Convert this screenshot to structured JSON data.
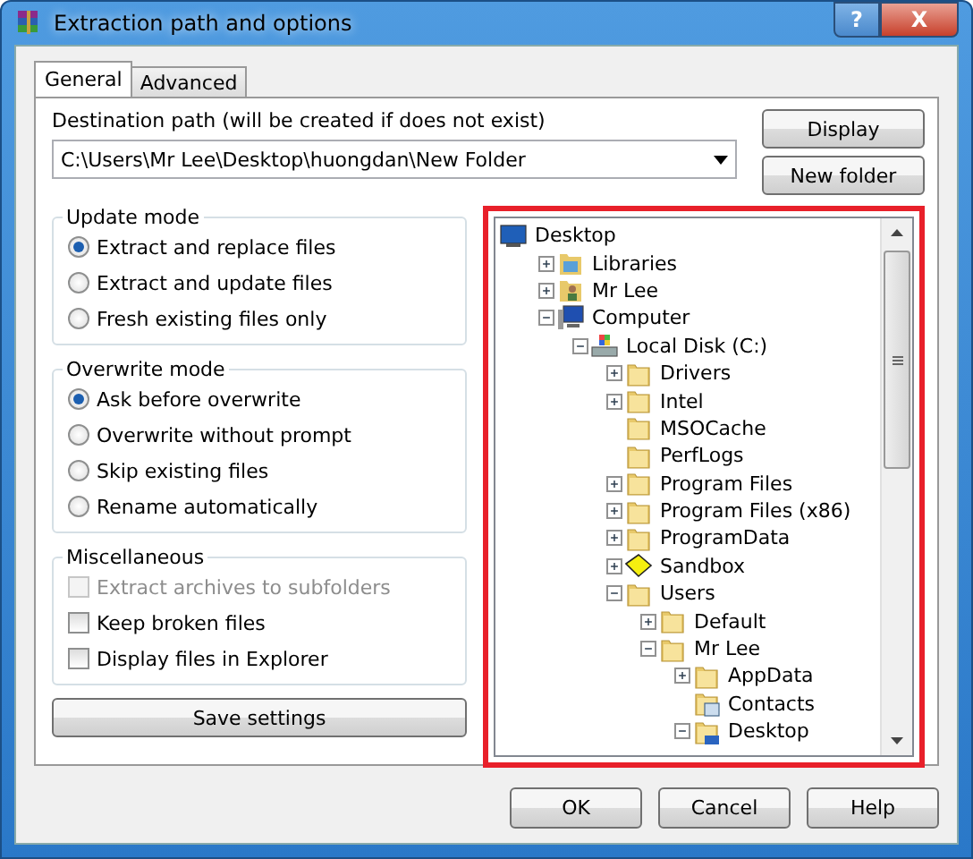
{
  "window": {
    "title": "Extraction path and options",
    "buttons": [
      {
        "kind": "help",
        "label": "?"
      },
      {
        "kind": "close",
        "label": "X"
      }
    ]
  },
  "tabs": [
    {
      "label": "General",
      "selected": true
    },
    {
      "label": "Advanced",
      "selected": false
    }
  ],
  "destination": {
    "label": "Destination path (will be created if does not exist)",
    "value": "C:\\Users\\Mr Lee\\Desktop\\huongdan\\New Folder"
  },
  "side_buttons": [
    "Display",
    "New folder"
  ],
  "update_mode": {
    "title": "Update mode",
    "options": [
      {
        "label": "Extract and replace files",
        "selected": true
      },
      {
        "label": "Extract and update files",
        "selected": false
      },
      {
        "label": "Fresh existing files only",
        "selected": false
      }
    ]
  },
  "overwrite_mode": {
    "title": "Overwrite mode",
    "options": [
      {
        "label": "Ask before overwrite",
        "selected": true
      },
      {
        "label": "Overwrite without prompt",
        "selected": false
      },
      {
        "label": "Skip existing files",
        "selected": false
      },
      {
        "label": "Rename automatically",
        "selected": false
      }
    ]
  },
  "miscellaneous": {
    "title": "Miscellaneous",
    "options": [
      {
        "label": "Extract archives to subfolders",
        "checked": false,
        "disabled": true
      },
      {
        "label": "Keep broken files",
        "checked": false,
        "disabled": false
      },
      {
        "label": "Display files in Explorer",
        "checked": false,
        "disabled": false
      }
    ]
  },
  "save_button": "Save settings",
  "tree": [
    {
      "label": "Desktop",
      "kind": "desktop",
      "children": [
        {
          "label": "Libraries",
          "kind": "library",
          "expanded": false
        },
        {
          "label": "Mr Lee",
          "kind": "user",
          "expanded": false
        },
        {
          "label": "Computer",
          "kind": "computer",
          "expanded": true,
          "children": [
            {
              "label": "Local Disk (C:)",
              "kind": "drive",
              "expanded": true,
              "children": [
                {
                  "label": "Drivers",
                  "kind": "folder",
                  "expanded": false
                },
                {
                  "label": "Intel",
                  "kind": "folder",
                  "expanded": false
                },
                {
                  "label": "MSOCache",
                  "kind": "folder"
                },
                {
                  "label": "PerfLogs",
                  "kind": "folder"
                },
                {
                  "label": "Program Files",
                  "kind": "folder",
                  "expanded": false
                },
                {
                  "label": "Program Files (x86)",
                  "kind": "folder",
                  "expanded": false
                },
                {
                  "label": "ProgramData",
                  "kind": "folder",
                  "expanded": false
                },
                {
                  "label": "Sandbox",
                  "kind": "sandbox",
                  "expanded": false
                },
                {
                  "label": "Users",
                  "kind": "folder",
                  "expanded": true,
                  "children": [
                    {
                      "label": "Default",
                      "kind": "folder",
                      "expanded": false
                    },
                    {
                      "label": "Mr Lee",
                      "kind": "folder",
                      "expanded": true,
                      "children": [
                        {
                          "label": "AppData",
                          "kind": "folder",
                          "expanded": false
                        },
                        {
                          "label": "Contacts",
                          "kind": "contacts"
                        },
                        {
                          "label": "Desktop",
                          "kind": "desktop-folder",
                          "expanded": true
                        }
                      ]
                    }
                  ]
                }
              ]
            }
          ]
        }
      ]
    }
  ],
  "footer_buttons": [
    "OK",
    "Cancel",
    "Help"
  ]
}
